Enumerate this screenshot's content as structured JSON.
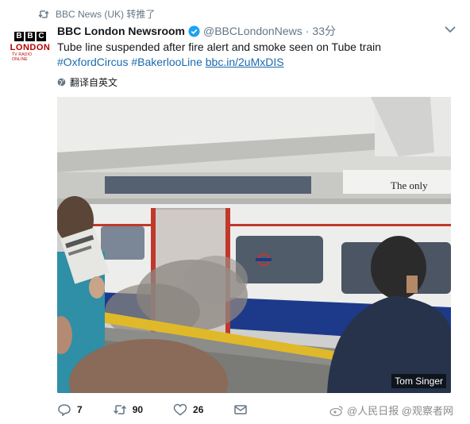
{
  "retweet": {
    "label": "BBC News (UK) 转推了"
  },
  "avatar": {
    "letters": [
      "B",
      "B",
      "C"
    ],
    "title": "LONDON",
    "subtitle": "TV RADIO ONLINE"
  },
  "tweet": {
    "author_name": "BBC London Newsroom",
    "handle": "@BBCLondonNews",
    "separator": "·",
    "time": "33分",
    "text_line1": "Tube line suspended after fire alert and smoke seen on Tube train",
    "hashtag1": "#OxfordCircus",
    "hashtag2": "#BakerlooLine",
    "link": "bbc.in/2uMxDIS",
    "translate_label": "翻译自英文"
  },
  "media": {
    "credit": "Tom Singer",
    "poster_text": "The only",
    "description_icon": "photo"
  },
  "actions": {
    "reply_count": "7",
    "retweet_count": "90",
    "like_count": "26"
  },
  "watermark": {
    "text": "@人民日报 @观察者网"
  },
  "colors": {
    "link": "#1b6ab0",
    "verified": "#1da1f2",
    "muted": "#657786"
  }
}
